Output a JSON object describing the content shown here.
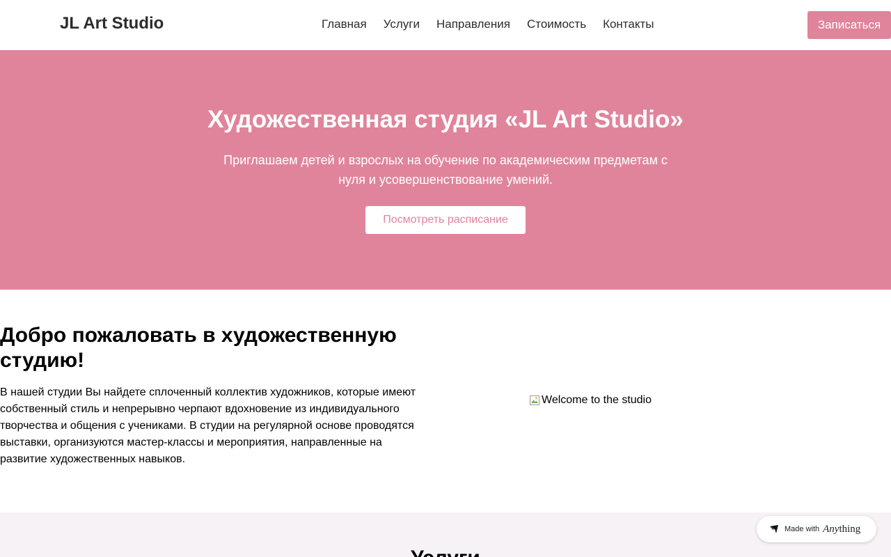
{
  "header": {
    "logo": "JL Art Studio",
    "nav": [
      "Главная",
      "Услуги",
      "Направления",
      "Стоимость",
      "Контакты"
    ],
    "signup_label": "Записаться"
  },
  "hero": {
    "title": "Художественная студия «JL Art Studio»",
    "subtitle": "Приглашаем детей и взрослых на обучение по академическим предметам с нуля и усовершенствование умений.",
    "schedule_label": "Посмотреть расписание"
  },
  "welcome": {
    "title": "Добро пожаловать в художественную студию!",
    "text": "В нашей студии Вы найдете сплоченный коллектив художников, которые имеют собственный стиль и непрерывно черпают вдохновение из индивидуального творчества и общения с учениками. В студии на регулярной основе проводятся выставки, организуются мастер-классы и мероприятия, направленные на развитие художественных навыков.",
    "image_alt": "Welcome to the studio"
  },
  "services": {
    "title": "Услуги"
  },
  "badge": {
    "made_with": "Made with",
    "brand_italic": "Any",
    "brand_rest": "thing"
  },
  "colors": {
    "accent": "#e0849b",
    "services_bg": "#f7f2f5"
  },
  "icons": {
    "badge_logo": "anything-logo-icon",
    "broken_image": "broken-image-icon"
  }
}
